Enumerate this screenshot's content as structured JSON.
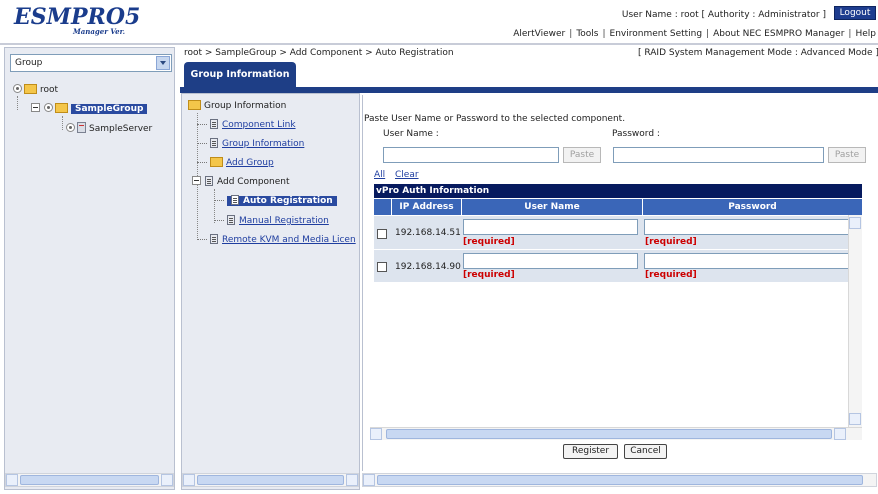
{
  "header": {
    "logo": "ESMPRO5",
    "logo_sub": "Manager Ver.",
    "user_info": "User Name : root  [ Authority : Administrator ]",
    "logout_label": "Logout",
    "nav": [
      "AlertViewer",
      "Tools",
      "Environment Setting",
      "About NEC ESMPRO Manager",
      "Help"
    ]
  },
  "left": {
    "group_select": "Group",
    "tree": {
      "root": "root",
      "group": "SampleGroup",
      "server": "SampleServer"
    }
  },
  "breadcrumb": "root > SampleGroup > Add Component > Auto Registration",
  "mode": "[ RAID System Management Mode : Advanced Mode ]",
  "tab": "Group Information",
  "menu": {
    "root": "Group Information",
    "items": [
      "Component Link",
      "Group Information",
      "Add Group",
      "Add Component",
      "Auto Registration",
      "Manual Registration",
      "Remote KVM and Media Licen"
    ]
  },
  "form": {
    "hint": "Paste User Name or Password to the selected component.",
    "user_label": "User Name :",
    "pass_label": "Password :",
    "paste_label": "Paste",
    "all_link": "All",
    "clear_link": "Clear"
  },
  "table": {
    "title": "vPro Auth Information",
    "headers": [
      "IP Address",
      "User Name",
      "Password"
    ],
    "rows": [
      {
        "ip": "192.168.14.51",
        "user_req": "[required]",
        "pass_req": "[required]"
      },
      {
        "ip": "192.168.14.90",
        "user_req": "[required]",
        "pass_req": "[required]"
      }
    ]
  },
  "actions": {
    "register": "Register",
    "cancel": "Cancel"
  },
  "colors": {
    "brand": "#1e3e86",
    "title_bar": "#061a5e",
    "header_bg": "#3a66b8",
    "required": "#cc0000"
  }
}
